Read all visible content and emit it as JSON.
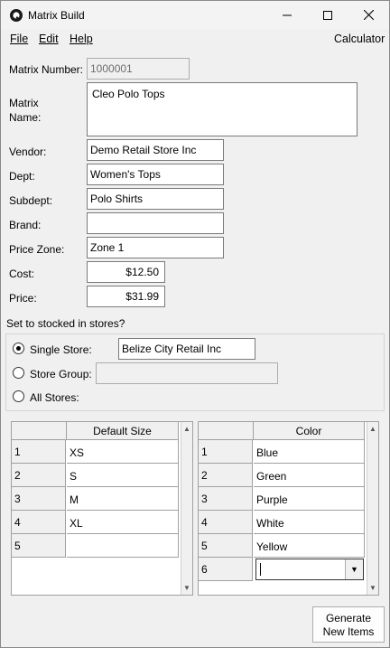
{
  "window": {
    "title": "Matrix Build",
    "minimize_icon": "minimize-icon",
    "maximize_icon": "maximize-icon",
    "close_icon": "close-icon"
  },
  "menu": {
    "file": "File",
    "edit": "Edit",
    "help": "Help",
    "calculator": "Calculator"
  },
  "form": {
    "matrix_number_label": "Matrix Number:",
    "matrix_number_value": "1000001",
    "matrix_name_label_1": "Matrix",
    "matrix_name_label_2": "Name:",
    "matrix_name_value": "Cleo Polo Tops",
    "vendor_label": "Vendor:",
    "vendor_value": "Demo Retail Store Inc",
    "dept_label": "Dept:",
    "dept_value": "Women's Tops",
    "subdept_label": "Subdept:",
    "subdept_value": "Polo Shirts",
    "brand_label": "Brand:",
    "brand_value": "",
    "price_zone_label": "Price Zone:",
    "price_zone_value": "Zone 1",
    "cost_label": "Cost:",
    "cost_value": "$12.50",
    "price_label": "Price:",
    "price_value": "$31.99"
  },
  "stocked": {
    "heading": "Set to stocked in stores?",
    "single_store_label": "Single Store:",
    "single_store_value": "Belize City Retail Inc",
    "store_group_label": "Store Group:",
    "store_group_value": "",
    "all_stores_label": "All Stores:",
    "selected": "single_store"
  },
  "size_grid": {
    "header": "Default Size",
    "rows": [
      {
        "num": "1",
        "value": "XS"
      },
      {
        "num": "2",
        "value": "S"
      },
      {
        "num": "3",
        "value": "M"
      },
      {
        "num": "4",
        "value": "XL"
      },
      {
        "num": "5",
        "value": ""
      }
    ]
  },
  "color_grid": {
    "header": "Color",
    "rows": [
      {
        "num": "1",
        "value": "Blue"
      },
      {
        "num": "2",
        "value": "Green"
      },
      {
        "num": "3",
        "value": "Purple"
      },
      {
        "num": "4",
        "value": "White"
      },
      {
        "num": "5",
        "value": "Yellow"
      },
      {
        "num": "6",
        "value": ""
      }
    ]
  },
  "actions": {
    "generate_line1": "Generate",
    "generate_line2": "New Items"
  }
}
